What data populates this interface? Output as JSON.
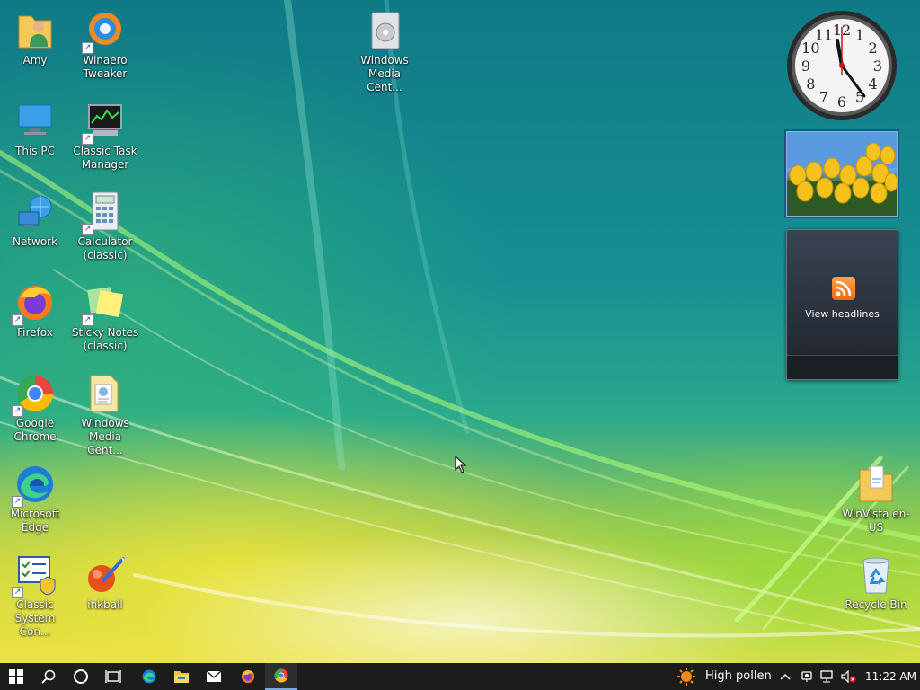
{
  "desktop": {
    "icons": [
      {
        "label": "Amy",
        "icon": "user-folder-icon"
      },
      {
        "label": "Winaero Tweaker",
        "icon": "winaero-tweaker-icon"
      },
      {
        "label": "Windows Media Cent...",
        "icon": "windows-media-center-icon"
      },
      {
        "label": "This PC",
        "icon": "computer-icon"
      },
      {
        "label": "Classic Task Manager",
        "icon": "task-manager-icon"
      },
      {
        "label": "Network",
        "icon": "network-icon"
      },
      {
        "label": "Calculator (classic)",
        "icon": "calculator-icon"
      },
      {
        "label": "Firefox",
        "icon": "firefox-icon"
      },
      {
        "label": "Sticky Notes (classic)",
        "icon": "sticky-notes-icon"
      },
      {
        "label": "Google Chrome",
        "icon": "chrome-icon"
      },
      {
        "label": "Windows Media Cent...",
        "icon": "windows-media-folder-icon"
      },
      {
        "label": "Microsoft Edge",
        "icon": "edge-icon"
      },
      {
        "label": "Classic System Con...",
        "icon": "system-configuration-icon"
      },
      {
        "label": "inkball",
        "icon": "inkball-icon"
      },
      {
        "label": "WinVista en-US",
        "icon": "folder-icon"
      },
      {
        "label": "Recycle Bin",
        "icon": "recycle-bin-icon"
      }
    ]
  },
  "gadgets": {
    "clock": {
      "numerals": [
        "12",
        "1",
        "2",
        "3",
        "4",
        "5",
        "6",
        "7",
        "8",
        "9",
        "10",
        "11"
      ]
    },
    "feeds": {
      "label": "View headlines"
    }
  },
  "taskbar": {
    "pinned": [
      "start-icon",
      "search-icon",
      "cortana-icon",
      "task-view-icon",
      "edge-icon",
      "file-explorer-icon",
      "mail-icon",
      "firefox-icon",
      "chrome-icon"
    ],
    "weather": "High pollen",
    "time": "11:22 AM"
  },
  "colors": {
    "taskbar": "#1c1c1c",
    "accent": "#7aa9dd"
  }
}
